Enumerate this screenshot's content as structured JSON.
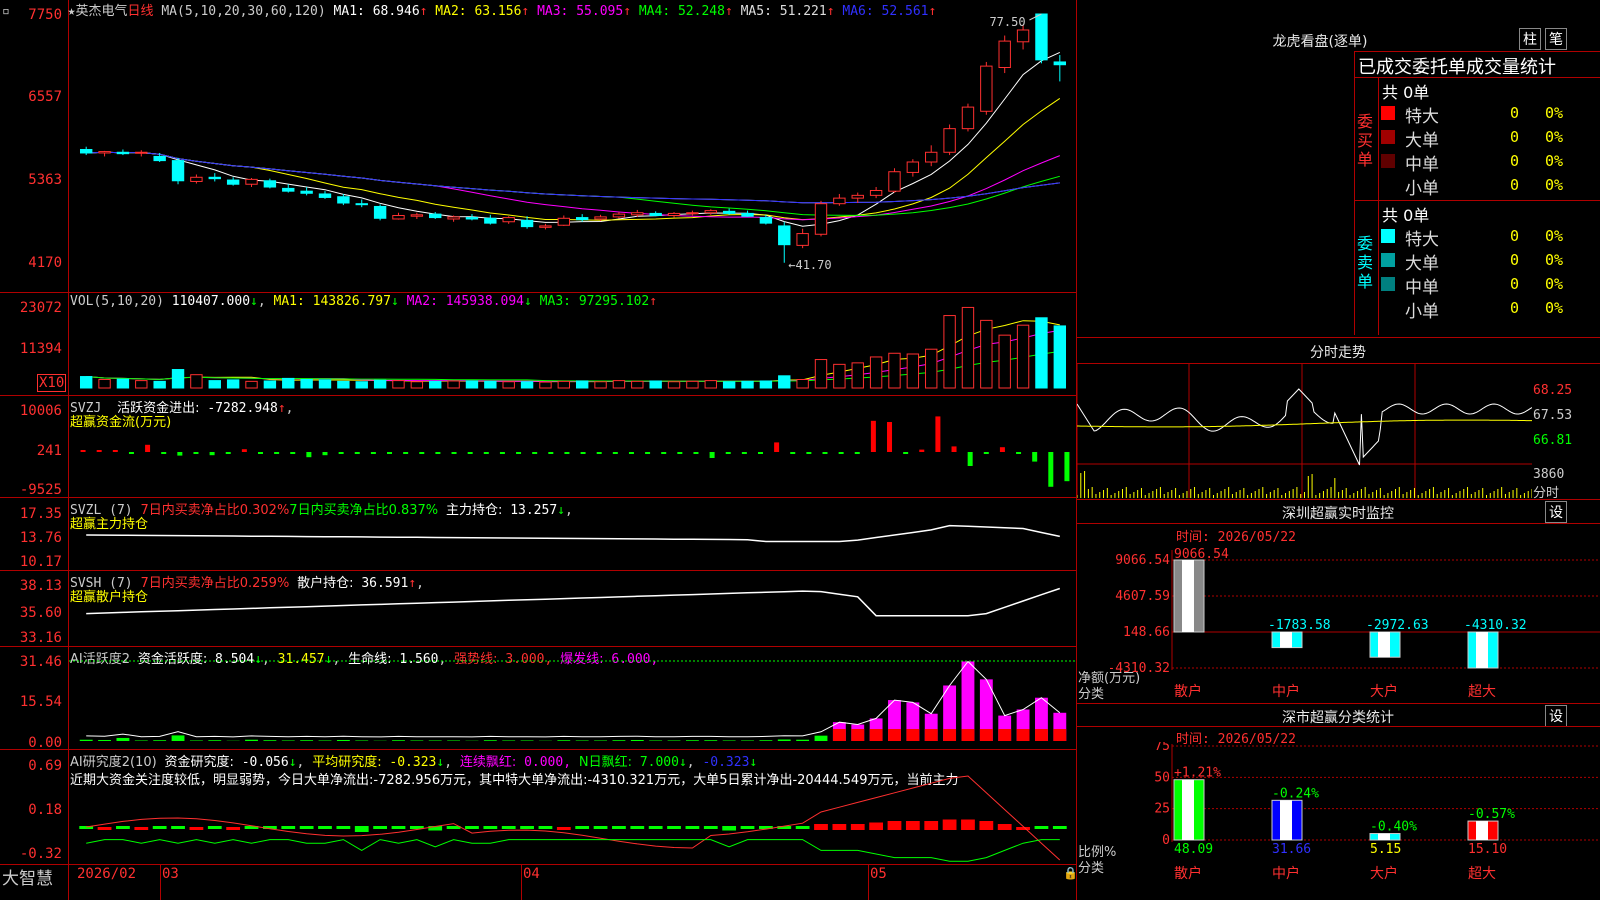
{
  "main_chart": {
    "stock_name": "英杰电气",
    "period": "日线",
    "ma_label": "MA(5,10,20,30,60,120)",
    "ma_values": [
      {
        "name": "MA1",
        "value": "68.946",
        "color": "#ffffff"
      },
      {
        "name": "MA2",
        "value": "63.156",
        "color": "#ffff00"
      },
      {
        "name": "MA3",
        "value": "55.095",
        "color": "#ff00ff"
      },
      {
        "name": "MA4",
        "value": "52.248",
        "color": "#00ff00"
      },
      {
        "name": "MA5",
        "value": "51.221",
        "color": "#dddddd"
      },
      {
        "name": "MA6",
        "value": "52.561",
        "color": "#3030ff"
      }
    ],
    "y_ticks": [
      "7750",
      "6557",
      "5363",
      "4170"
    ],
    "high_label": "77.50",
    "low_label": "41.70"
  },
  "volume_pane": {
    "label": "VOL(5,10,20)",
    "value": "110407.000",
    "ma": [
      {
        "name": "MA1",
        "value": "143826.797",
        "color": "#ffff00"
      },
      {
        "name": "MA2",
        "value": "145938.094",
        "color": "#ff00ff"
      },
      {
        "name": "MA3",
        "value": "97295.102",
        "color": "#00ff00"
      }
    ],
    "y_ticks": [
      "23072",
      "11394"
    ],
    "unit": "X10"
  },
  "svzj_pane": {
    "label": "SVZJ",
    "metric": "活跃资金进出:",
    "value": "-7282.948",
    "subtitle": "超赢资金流(万元)",
    "y_ticks": [
      "10006",
      "241",
      "-9525"
    ]
  },
  "svzl_pane": {
    "label": "SVZL (7)",
    "red_text": "7日内买卖净占比0.302%",
    "green_text": "7日内买卖净占比0.837%",
    "metric": "主力持仓:",
    "value": "13.257",
    "subtitle": "超赢主力持仓",
    "y_ticks": [
      "17.35",
      "13.76",
      "10.17"
    ]
  },
  "svsh_pane": {
    "label": "SVSH (7)",
    "red_text": "7日内买卖净占比0.259%",
    "metric": "散户持仓:",
    "value": "36.591",
    "subtitle": "超赢散户持仓",
    "y_ticks": [
      "38.13",
      "35.60",
      "33.16"
    ]
  },
  "ai_active_pane": {
    "label": "AI活跃度2",
    "metric": "资金活跃度:",
    "value": "8.504",
    "value2": "31.457",
    "life_label": "生命线:",
    "life_value": "1.560",
    "strong_label": "强势线:",
    "strong_value": "3.000",
    "burst_label": "爆发线:",
    "burst_value": "6.000",
    "y_ticks": [
      "31.46",
      "15.54",
      "0.00"
    ]
  },
  "ai_research_pane": {
    "label": "AI研究度2(10)",
    "metric": "资金研究度:",
    "value": "-0.056",
    "avg_label": "平均研究度:",
    "avg_value": "-0.323",
    "cont_label": "连续飘红:",
    "cont_value": "0.000",
    "n_label": "N日飘红:",
    "n_value": "7.000",
    "last_value": "-0.323",
    "commentary": "近期大资金关注度较低，明显弱势，今日大单净流出:-7282.956万元，其中特大单净流出:-4310.321万元，大单5日累计净出-20444.549万元，当前主力",
    "y_ticks": [
      "0.69",
      "0.18",
      "-0.32"
    ]
  },
  "x_axis": {
    "brand": "大智慧",
    "labels": [
      "2026/02",
      "03",
      "04",
      "05"
    ]
  },
  "longhu": {
    "title": "龙虎看盘(逐单)",
    "btn1": "柱",
    "btn2": "笔",
    "header": "已成交委托单成交量统计",
    "buy_total": "共 0单",
    "buy_side": "委买单",
    "sell_total": "共 0单",
    "sell_side": "委卖单",
    "buy_rows": [
      {
        "label": "特大",
        "count": "0",
        "pct": "0%",
        "color": "#ff0000"
      },
      {
        "label": "大单",
        "count": "0",
        "pct": "0%",
        "color": "#a00000"
      },
      {
        "label": "中单",
        "count": "0",
        "pct": "0%",
        "color": "#600000"
      },
      {
        "label": "小单",
        "count": "0",
        "pct": "0%",
        "color": "#000000"
      }
    ],
    "sell_rows": [
      {
        "label": "特大",
        "count": "0",
        "pct": "0%",
        "color": "#00ffff"
      },
      {
        "label": "大单",
        "count": "0",
        "pct": "0%",
        "color": "#00a0a0"
      },
      {
        "label": "中单",
        "count": "0",
        "pct": "0%",
        "color": "#008080"
      },
      {
        "label": "小单",
        "count": "0",
        "pct": "0%",
        "color": "#000000"
      }
    ]
  },
  "intraday": {
    "title": "分时走势",
    "y_ticks": [
      "68.25",
      "67.53",
      "66.81"
    ],
    "vol_tick": "3860",
    "unit": "分时"
  },
  "sz_monitor": {
    "title": "深圳超赢实时监控",
    "btn": "设",
    "time": "时间: 2026/05/22",
    "y_ticks": [
      "9066.54",
      "4607.59",
      "148.66",
      "-4310.32"
    ],
    "y_label": "净额(万元)",
    "x_label": "分类",
    "categories": [
      "散户",
      "中户",
      "大户",
      "超大"
    ],
    "values": [
      "9066.54",
      "-1783.58",
      "-2972.63",
      "-4310.32"
    ],
    "chart_data": {
      "type": "bar",
      "categories": [
        "散户",
        "中户",
        "大户",
        "超大"
      ],
      "values": [
        9066.54,
        -1783.58,
        -2972.63,
        -4310.32
      ],
      "ylabel": "净额(万元)",
      "xlabel": "分类",
      "ylim": [
        -4310.32,
        9066.54
      ]
    }
  },
  "sz_class": {
    "title": "深市超赢分类统计",
    "btn": "设",
    "time": "时间: 2026/05/22",
    "y_ticks": [
      "75",
      "50",
      "25",
      "0"
    ],
    "y_label": "比例%",
    "x_label": "分类",
    "categories": [
      "散户",
      "中户",
      "大户",
      "超大"
    ],
    "top_values": [
      "+1.21%",
      "-0.24%",
      "-0.40%",
      "-0.57%"
    ],
    "bottom_values": [
      "48.09",
      "31.66",
      "5.15",
      "15.10"
    ],
    "chart_data": {
      "type": "bar",
      "categories": [
        "散户",
        "中户",
        "大户",
        "超大"
      ],
      "values": [
        48.09,
        31.66,
        5.15,
        15.1
      ],
      "changes": [
        "+1.21%",
        "-0.24%",
        "-0.40%",
        "-0.57%"
      ],
      "ylabel": "比例%",
      "xlabel": "分类",
      "ylim": [
        0,
        75
      ]
    }
  },
  "candles": [
    [
      58.0,
      58.4,
      57.2,
      57.5
    ],
    [
      57.5,
      57.8,
      57.0,
      57.7
    ],
    [
      57.6,
      58.0,
      57.2,
      57.4
    ],
    [
      57.5,
      57.9,
      57.0,
      57.6
    ],
    [
      57.0,
      57.5,
      56.2,
      56.4
    ],
    [
      56.4,
      56.8,
      53.0,
      53.5
    ],
    [
      53.4,
      54.4,
      53.1,
      54.0
    ],
    [
      54.0,
      54.6,
      53.4,
      53.8
    ],
    [
      53.6,
      54.0,
      52.8,
      53.0
    ],
    [
      53.0,
      53.9,
      52.6,
      53.7
    ],
    [
      53.5,
      53.8,
      52.4,
      52.6
    ],
    [
      52.4,
      53.0,
      51.8,
      52.0
    ],
    [
      52.0,
      52.6,
      51.4,
      51.7
    ],
    [
      51.6,
      52.0,
      50.9,
      51.1
    ],
    [
      51.2,
      51.6,
      50.0,
      50.3
    ],
    [
      50.2,
      50.8,
      49.7,
      50.1
    ],
    [
      49.8,
      50.1,
      47.8,
      48.1
    ],
    [
      48.0,
      48.9,
      47.9,
      48.5
    ],
    [
      48.4,
      48.9,
      48.0,
      48.6
    ],
    [
      48.7,
      49.0,
      48.0,
      48.2
    ],
    [
      48.0,
      48.5,
      47.6,
      48.3
    ],
    [
      48.2,
      48.7,
      47.8,
      48.0
    ],
    [
      48.1,
      48.6,
      47.2,
      47.4
    ],
    [
      47.6,
      48.4,
      47.3,
      48.2
    ],
    [
      47.8,
      48.4,
      46.6,
      46.9
    ],
    [
      46.8,
      47.3,
      46.5,
      47.0
    ],
    [
      47.1,
      48.5,
      47.0,
      48.1
    ],
    [
      48.2,
      48.7,
      47.6,
      47.9
    ],
    [
      48.0,
      48.6,
      47.7,
      48.3
    ],
    [
      48.3,
      49.0,
      48.1,
      48.7
    ],
    [
      48.6,
      49.3,
      48.3,
      48.9
    ],
    [
      48.8,
      49.1,
      48.4,
      48.5
    ],
    [
      48.5,
      49.0,
      48.2,
      48.8
    ],
    [
      48.8,
      49.2,
      48.5,
      48.9
    ],
    [
      48.9,
      49.4,
      48.6,
      49.2
    ],
    [
      49.1,
      49.5,
      48.6,
      48.8
    ],
    [
      48.8,
      49.2,
      48.3,
      48.4
    ],
    [
      48.2,
      48.6,
      47.2,
      47.4
    ],
    [
      47.0,
      47.6,
      41.7,
      44.3
    ],
    [
      44.2,
      46.6,
      43.8,
      45.9
    ],
    [
      45.8,
      50.6,
      45.5,
      50.2
    ],
    [
      50.2,
      51.6,
      49.9,
      51.0
    ],
    [
      51.0,
      51.8,
      50.3,
      51.4
    ],
    [
      51.4,
      52.6,
      51.0,
      52.1
    ],
    [
      52.0,
      55.3,
      51.8,
      54.8
    ],
    [
      54.7,
      56.6,
      54.1,
      56.2
    ],
    [
      56.2,
      58.6,
      55.6,
      57.6
    ],
    [
      57.6,
      61.6,
      57.2,
      61.0
    ],
    [
      61.0,
      64.6,
      60.6,
      64.1
    ],
    [
      63.5,
      70.6,
      63.0,
      70.0
    ],
    [
      69.8,
      74.4,
      69.0,
      73.6
    ],
    [
      73.5,
      75.9,
      72.4,
      75.2
    ],
    [
      77.5,
      77.5,
      70.4,
      70.9
    ],
    [
      70.6,
      71.6,
      67.8,
      70.2
    ]
  ],
  "volumes": [
    31,
    23,
    24,
    20,
    18,
    50,
    36,
    20,
    22,
    18,
    19,
    26,
    23,
    22,
    18,
    17,
    21,
    20,
    17,
    18,
    19,
    19,
    18,
    17,
    17,
    16,
    18,
    19,
    17,
    20,
    18,
    19,
    17,
    18,
    20,
    17,
    18,
    19,
    33,
    23,
    77,
    64,
    68,
    84,
    94,
    92,
    105,
    196,
    218,
    183,
    143,
    170,
    190,
    168
  ],
  "svzj": [
    200,
    150,
    300,
    -100,
    1800,
    -250,
    -900,
    -200,
    -800,
    -400,
    700,
    -100,
    -150,
    -300,
    -1300,
    -800,
    -200,
    -100,
    -300,
    -200,
    -150,
    -200,
    -250,
    -300,
    -400,
    -300,
    -200,
    -300,
    -250,
    -200,
    -150,
    -200,
    -100,
    -200,
    -300,
    -250,
    -200,
    -300,
    -500,
    -1500,
    -200,
    -300,
    -100,
    2400,
    -100,
    -100,
    -100,
    -200,
    -300,
    7800,
    7500,
    -100,
    600,
    8900,
    1400,
    -3500,
    -100,
    1200,
    -200,
    -2400,
    -8700,
    -7300
  ]
}
